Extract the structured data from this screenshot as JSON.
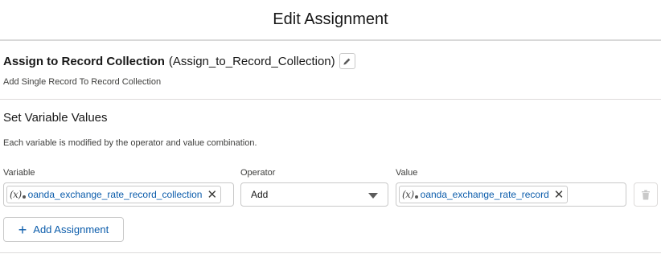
{
  "header": {
    "title": "Edit Assignment"
  },
  "element": {
    "label": "Assign to Record Collection",
    "api_name": "(Assign_to_Record_Collection)",
    "description": "Add Single Record To Record Collection"
  },
  "section": {
    "title": "Set Variable Values",
    "help": "Each variable is modified by the operator and value combination."
  },
  "columns": {
    "variable": "Variable",
    "operator": "Operator",
    "value": "Value"
  },
  "row": {
    "variable": "oanda_exchange_rate_record_collection",
    "operator": "Add",
    "value": "oanda_exchange_rate_record"
  },
  "icons": {
    "variable_icon": "(𝑥)",
    "remove": "✕",
    "edit": "pencil-icon",
    "delete": "trash-icon",
    "add": "+"
  },
  "buttons": {
    "add_assignment": "Add Assignment"
  }
}
